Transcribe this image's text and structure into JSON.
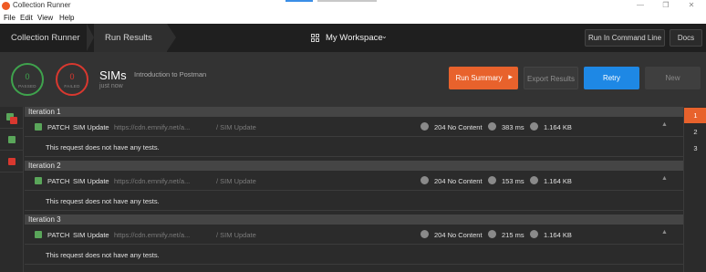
{
  "window": {
    "title": "Collection Runner"
  },
  "menu": [
    "File",
    "Edit",
    "View",
    "Help"
  ],
  "header": {
    "crumbs": [
      "Collection Runner",
      "Run Results"
    ],
    "workspace": "My Workspace",
    "run_cmd_btn": "Run In Command Line",
    "docs_btn": "Docs"
  },
  "summary": {
    "passed": {
      "count": "0",
      "label": "PASSED",
      "color": "#3fa34d"
    },
    "failed": {
      "count": "0",
      "label": "FAILED",
      "color": "#d9382f"
    },
    "title": "SIMs",
    "collection": "Introduction to Postman",
    "time": "just now",
    "buttons": {
      "run_summary": "Run Summary",
      "export": "Export Results",
      "retry": "Retry",
      "new": "New"
    }
  },
  "iterations": [
    {
      "label": "Iteration 1",
      "request": {
        "method": "PATCH",
        "name": "SIM Update",
        "url": "https://cdn.emnify.net/a...",
        "path": "/ SIM Update",
        "status": "204 No Content",
        "time": "383 ms",
        "size": "1.164 KB"
      },
      "note": "This request does not have any tests."
    },
    {
      "label": "Iteration 2",
      "request": {
        "method": "PATCH",
        "name": "SIM Update",
        "url": "https://cdn.emnify.net/a...",
        "path": "/ SIM Update",
        "status": "204 No Content",
        "time": "153 ms",
        "size": "1.164 KB"
      },
      "note": "This request does not have any tests."
    },
    {
      "label": "Iteration 3",
      "request": {
        "method": "PATCH",
        "name": "SIM Update",
        "url": "https://cdn.emnify.net/a...",
        "path": "/ SIM Update",
        "status": "204 No Content",
        "time": "215 ms",
        "size": "1.164 KB"
      },
      "note": "This request does not have any tests."
    }
  ],
  "pager": [
    "1",
    "2",
    "3"
  ],
  "colors": {
    "accent_orange": "#e8622c",
    "retry_blue": "#1e88e5",
    "pass_green": "#5aa65a",
    "fail_red": "#d9382f"
  }
}
